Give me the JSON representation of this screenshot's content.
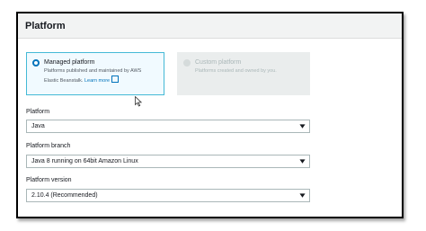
{
  "panel": {
    "title": "Platform"
  },
  "platform_type": {
    "managed": {
      "title": "Managed platform",
      "description_line1": "Platforms published and maintained by AWS",
      "description_line2": "Elastic Beanstalk.",
      "learn_more": "Learn more",
      "selected": true
    },
    "custom": {
      "title": "Custom platform",
      "description": "Platforms created and owned by you.",
      "selected": false,
      "disabled": true
    }
  },
  "fields": {
    "platform": {
      "label": "Platform",
      "value": "Java"
    },
    "platform_branch": {
      "label": "Platform branch",
      "value": "Java 8 running on 64bit Amazon Linux"
    },
    "platform_version": {
      "label": "Platform version",
      "value": "2.10.4 (Recommended)"
    }
  },
  "colors": {
    "accent": "#0073bb",
    "selected_border": "#44b9d6",
    "selected_bg": "#f1faff",
    "header_bg": "#f2f3f3"
  }
}
